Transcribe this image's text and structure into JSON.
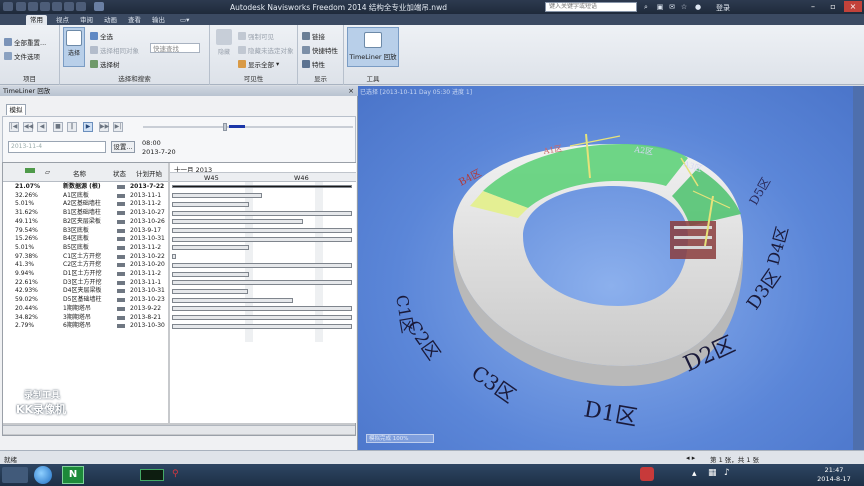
{
  "window": {
    "title": "Autodesk Navisworks Freedom 2014    结构全专业加端吊.nwd",
    "search_placeholder": "键入关键字或短语",
    "login_label": "登录"
  },
  "menu_tabs": [
    "常用",
    "视点",
    "审阅",
    "动画",
    "查看",
    "输出"
  ],
  "ribbon": {
    "project": {
      "label": "项目",
      "items": [
        "全部重置...",
        "文件选项"
      ]
    },
    "select_search": {
      "label": "选择和搜索",
      "select_btn": "选择",
      "items": [
        "全选",
        "选择相同对象",
        "快速查找",
        "选择树"
      ]
    },
    "visibility": {
      "label": "可见性",
      "hide_btn": "隐藏",
      "items": [
        "强制可见",
        "隐藏未选定对象",
        "显示全部"
      ]
    },
    "display": {
      "label": "显示",
      "items": [
        "链接",
        "快捷特性",
        "特性"
      ]
    },
    "tools": {
      "label": "工具",
      "timeliner_btn": "TimeLiner 回放"
    }
  },
  "panel": {
    "title": "TimeLiner 回放",
    "sim_tab": "模拟",
    "date_field": "2013-11-4",
    "settings_btn": "设置...",
    "time": "08:00",
    "date": "2013-7-20",
    "progress": 0.45,
    "columns": [
      "名称",
      "状态",
      "计划开始"
    ],
    "gantt_month": "十一月 2013",
    "weeks": [
      "W45",
      "W46"
    ],
    "rows": [
      {
        "pct": "21.07%",
        "name": "新数据源 (根)",
        "date": "2013-7-22",
        "bold": true,
        "bar": [
          0.0,
          1.0
        ]
      },
      {
        "pct": "32.26%",
        "name": "A1区底板",
        "date": "2013-11-1",
        "bar": [
          0.0,
          0.5
        ]
      },
      {
        "pct": "5.01%",
        "name": "A2区基础墙柱",
        "date": "2013-11-2",
        "bar": [
          0.0,
          0.43
        ]
      },
      {
        "pct": "31.62%",
        "name": "B1区基础墙柱",
        "date": "2013-10-27",
        "bar": [
          0.0,
          1.0
        ]
      },
      {
        "pct": "49.11%",
        "name": "B2区夹层梁板",
        "date": "2013-10-26",
        "bar": [
          0.0,
          0.73
        ]
      },
      {
        "pct": "79.54%",
        "name": "B3区底板",
        "date": "2013-9-17",
        "bar": [
          0.0,
          1.0
        ]
      },
      {
        "pct": "15.26%",
        "name": "B4区底板",
        "date": "2013-10-31",
        "bar": [
          0.0,
          1.0
        ]
      },
      {
        "pct": "5.01%",
        "name": "B5区底板",
        "date": "2013-11-2",
        "bar": [
          0.0,
          0.43
        ]
      },
      {
        "pct": "97.38%",
        "name": "C1区土方开挖",
        "date": "2013-10-22",
        "bar": [
          0.0,
          0.02
        ]
      },
      {
        "pct": "41.3%",
        "name": "C2区土方开挖",
        "date": "2013-10-20",
        "bar": [
          0.0,
          1.0
        ]
      },
      {
        "pct": "9.94%",
        "name": "D1区土方开挖",
        "date": "2013-11-2",
        "bar": [
          0.0,
          0.43
        ]
      },
      {
        "pct": "22.61%",
        "name": "D3区土方开挖",
        "date": "2013-11-1",
        "bar": [
          0.0,
          1.0
        ]
      },
      {
        "pct": "42.93%",
        "name": "D4区夹层梁板",
        "date": "2013-10-31",
        "bar": [
          0.0,
          0.42
        ]
      },
      {
        "pct": "59.02%",
        "name": "D5区基础墙柱",
        "date": "2013-10-23",
        "bar": [
          0.0,
          0.67
        ]
      },
      {
        "pct": "20.44%",
        "name": "1期期塔吊",
        "date": "2013-9-22",
        "bar": [
          0.0,
          1.0
        ]
      },
      {
        "pct": "34.82%",
        "name": "3期期塔吊",
        "date": "2013-8-21",
        "bar": [
          0.0,
          1.0
        ]
      },
      {
        "pct": "2.79%",
        "name": "6期期塔吊",
        "date": "2013-10-30",
        "bar": [
          0.0,
          1.0
        ]
      }
    ]
  },
  "watermark": {
    "line1": "录制工具",
    "line2": "KK录像机"
  },
  "viewport": {
    "header": "已选择  [2013-10-11  Day  05:30  进度  1]",
    "status": "模拟完成  100%",
    "zones": [
      "C1区",
      "C2区",
      "C3区",
      "D1区",
      "D2区",
      "D3区",
      "D4区",
      "D5区",
      "B4区",
      "A1区",
      "A2区",
      "A3区"
    ]
  },
  "statusbar": {
    "ready": "就绪",
    "page": "第 1 张，共 1 张"
  },
  "taskbar": {
    "time": "21:47",
    "date": "2014-8-17"
  },
  "colors": {
    "accent": "#b8cfe9",
    "progress": "#1b36a8",
    "viewport_bg": "#5b86d8",
    "zone_text": "#1a1a3a"
  }
}
